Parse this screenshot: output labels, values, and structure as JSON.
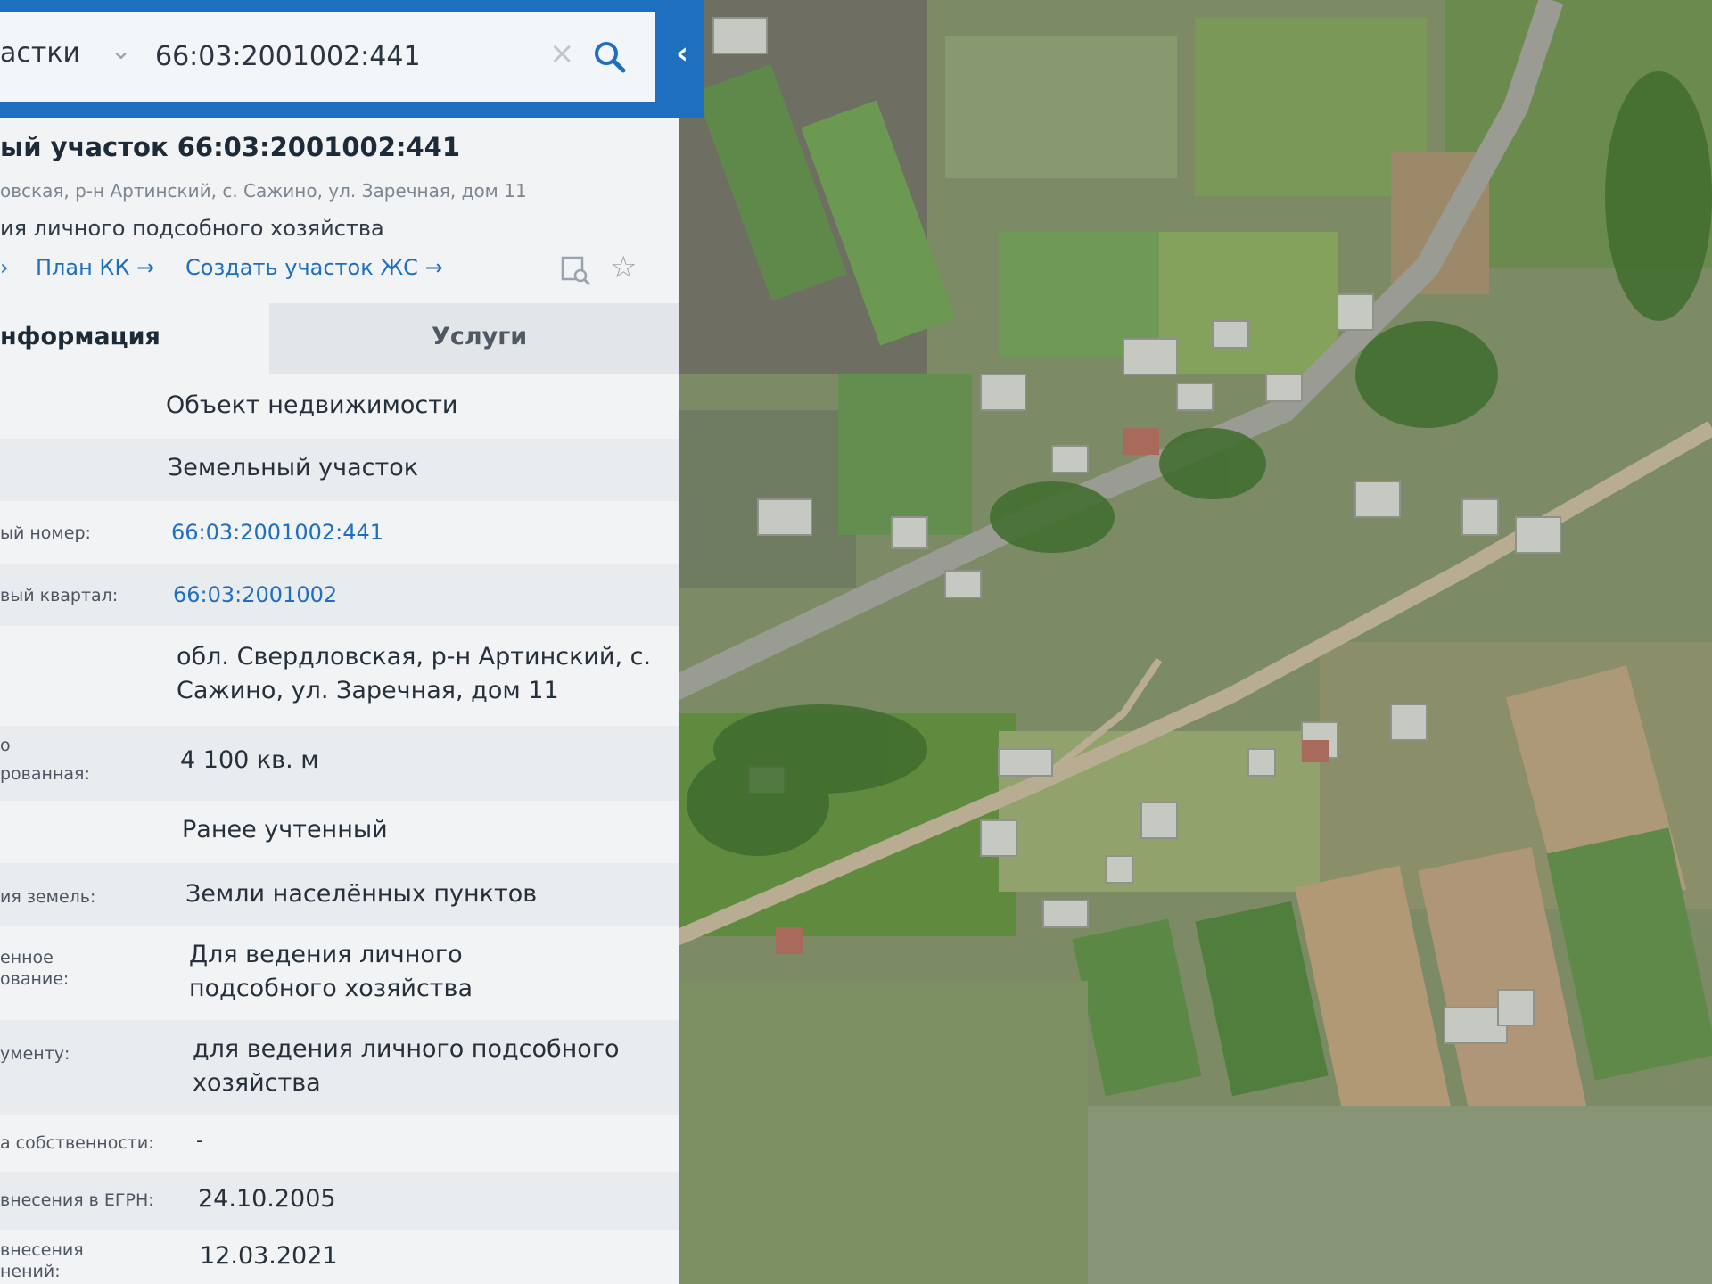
{
  "search": {
    "category": "астки",
    "query": "66:03:2001002:441"
  },
  "panel": {
    "title": "ый участок 66:03:2001002:441",
    "address_short": "овская, р-н Артинский, с. Сажино, ул. Заречная, дом 11",
    "purpose_short": "ия личного подсобного хозяйства",
    "links": {
      "lead_arrow": "›",
      "plan": "План КК →",
      "create": "Создать участок ЖС →"
    },
    "tabs": {
      "info": "нформация",
      "services": "Услуги"
    },
    "rows": [
      {
        "label": "",
        "value": "Объект недвижимости"
      },
      {
        "label": "",
        "value": "Земельный участок"
      },
      {
        "label": "ый номер:",
        "value": "66:03:2001002:441"
      },
      {
        "label": "вый квартал:",
        "value": "66:03:2001002"
      },
      {
        "label": "",
        "value": "обл. Свердловская, р-н Артинский, с. Сажино, ул. Заречная, дом 11"
      },
      {
        "label": "рованная:",
        "label_top": "о",
        "value": "4 100 кв. м"
      },
      {
        "label": "",
        "value": "Ранее учтенный"
      },
      {
        "label": "ия земель:",
        "value": "Земли населённых пунктов"
      },
      {
        "label": "енное",
        "label2": "ование:",
        "value": "Для ведения личного подсобного хозяйства"
      },
      {
        "label": "ументу:",
        "value": "для ведения личного подсобного хозяйства"
      },
      {
        "label": "а собственности:",
        "value": "-"
      },
      {
        "label": "внесения в ЕГРН:",
        "value": "24.10.2005"
      },
      {
        "label": "внесения",
        "label2": "нений:",
        "value": "12.03.2021"
      }
    ]
  },
  "colors": {
    "accent": "#1f6fc1",
    "panel_bg": "#f1f3f5"
  }
}
